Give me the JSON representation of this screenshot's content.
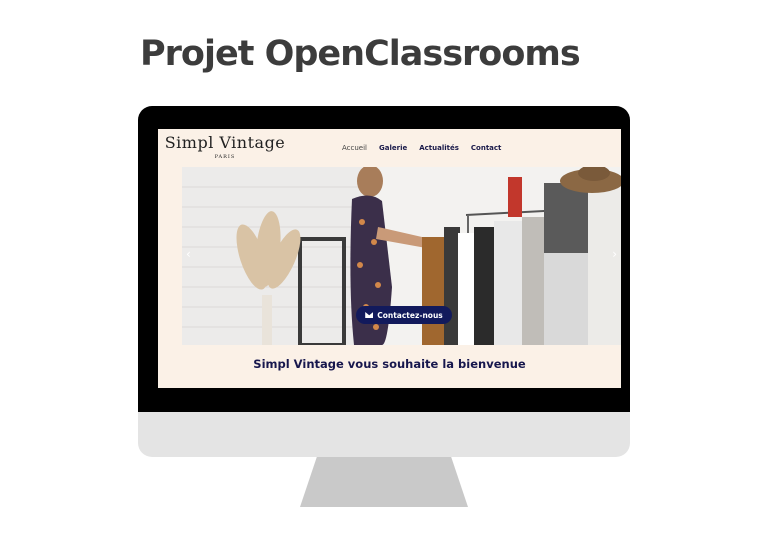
{
  "page": {
    "title": "Projet OpenClassrooms"
  },
  "site": {
    "logo_name": "Simpl Vintage",
    "logo_sub": "PARIS",
    "nav": [
      {
        "label": "Accueil"
      },
      {
        "label": "Galerie"
      },
      {
        "label": "Actualités"
      },
      {
        "label": "Contact"
      }
    ],
    "cta_label": "Contactez-nous",
    "welcome": "Simpl Vintage vous souhaite la bienvenue",
    "colors": {
      "accent": "#121a5c",
      "background": "#fbf1e7"
    }
  }
}
